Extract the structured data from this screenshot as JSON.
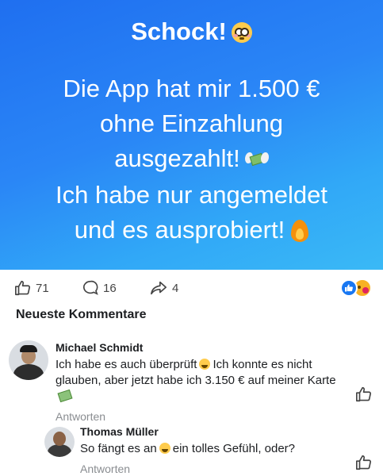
{
  "banner": {
    "headline": "Schock!",
    "paragraph1": [
      "Die App hat mir 1.500 €",
      "ohne Einzahlung",
      "ausgezahlt!"
    ],
    "paragraph2": [
      "Ich habe nur angemeldet",
      "und es ausprobiert!"
    ]
  },
  "reactions": {
    "likes": "71",
    "comments": "16",
    "shares": "4"
  },
  "section": {
    "title": "Neueste Kommentare"
  },
  "comments": [
    {
      "author": "Michael Schmidt",
      "text_part1": "Ich habe es auch überprüft",
      "text_part2": "Ich konnte es nicht glauben, aber jetzt habe ich 3.150 € auf meiner Karte",
      "reply_label": "Antworten"
    },
    {
      "author": "Thomas Müller",
      "text_part1": "So fängt es an",
      "text_part2": "ein tolles Gefühl, oder?",
      "reply_label": "Antworten"
    }
  ],
  "colors": {
    "banner_start": "#1f6ff0",
    "banner_end": "#3ab9f6",
    "like_blue": "#1877f2",
    "muted": "#8a8d91"
  },
  "icons": [
    "flushed-face-icon",
    "money-with-wings-icon",
    "fire-icon",
    "thumbs-up-icon",
    "comment-bubble-icon",
    "share-arrow-icon",
    "like-reaction-icon",
    "love-reaction-icon",
    "grinning-face-icon"
  ]
}
